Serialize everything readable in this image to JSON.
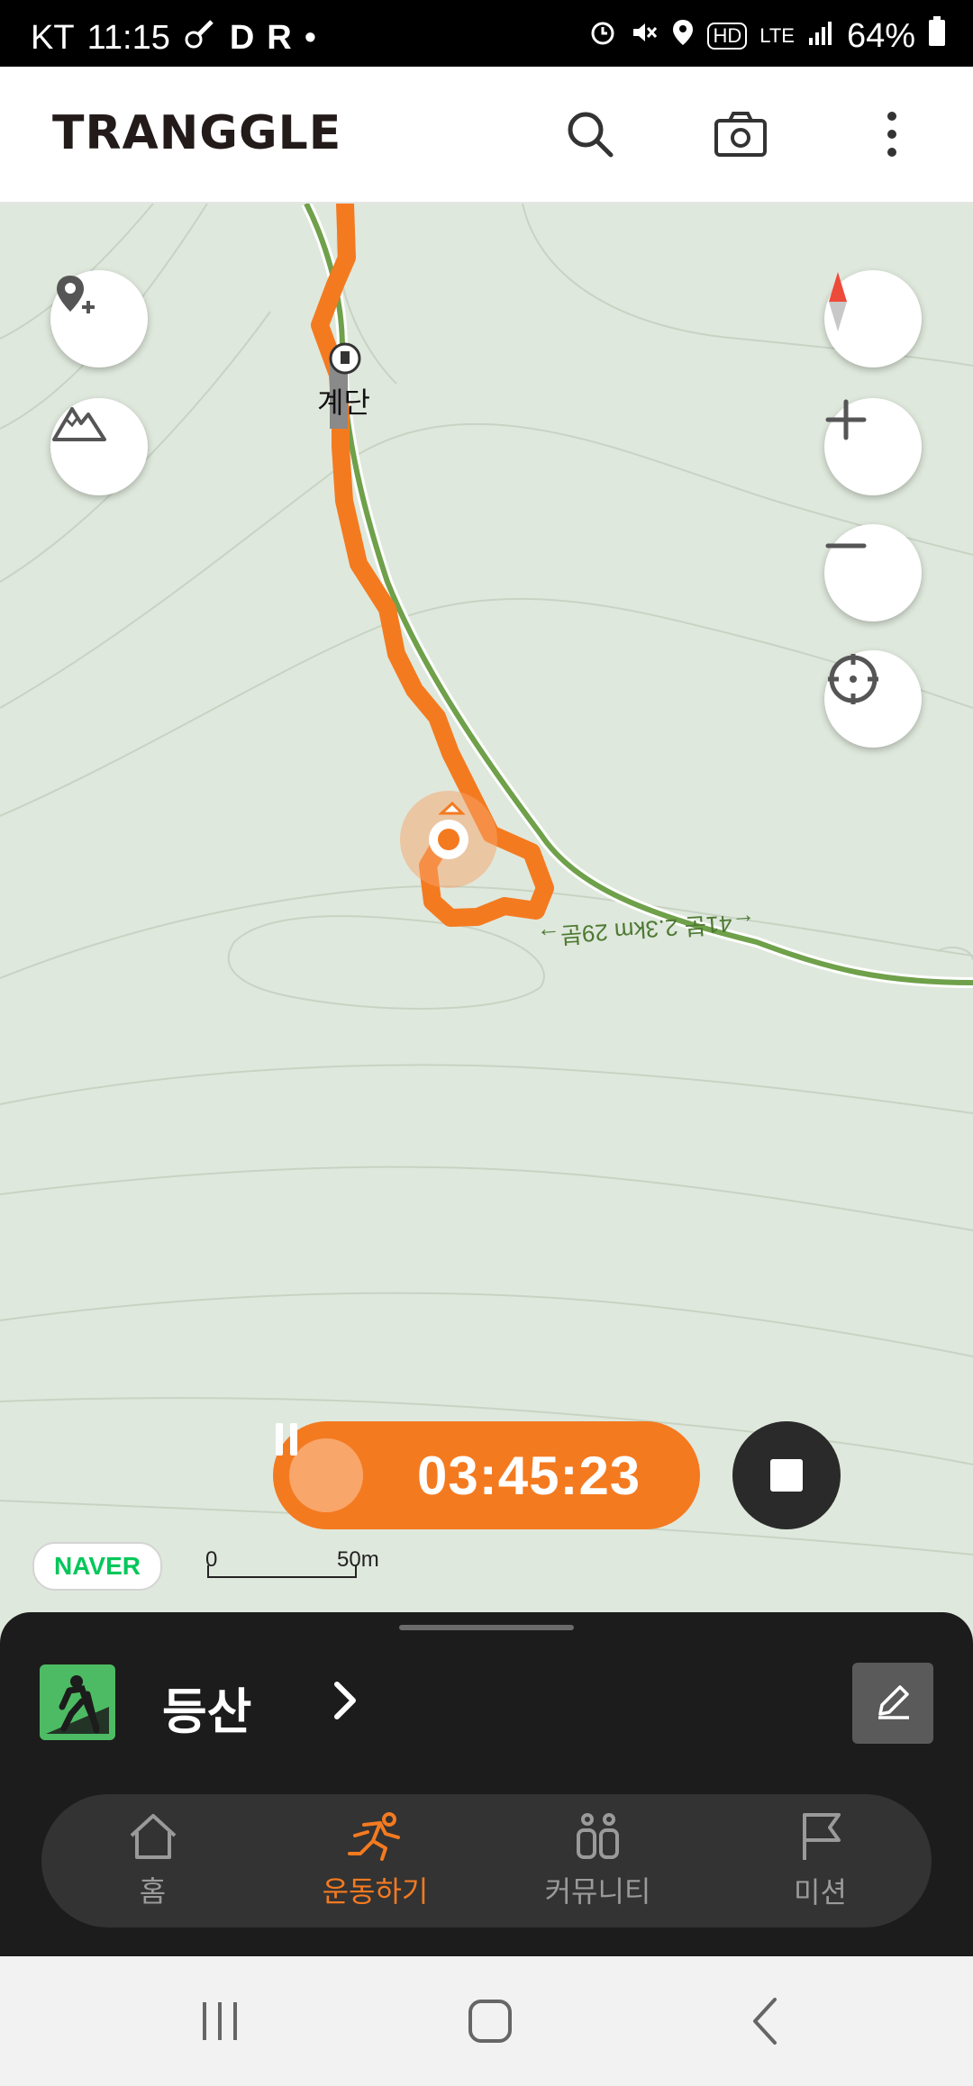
{
  "status_bar": {
    "carrier": "KT",
    "time": "11:15",
    "indicator_d": "D",
    "indicator_r": "R",
    "network": "LTE",
    "battery": "64%"
  },
  "header": {
    "logo": "TRANGGLE"
  },
  "map": {
    "poi_label": "계단",
    "trail_label": "←41분 2.3km 29분→",
    "attribution": "NAVER",
    "scale_start": "0",
    "scale_end": "50m"
  },
  "tracker": {
    "elapsed": "03:45:23"
  },
  "activity": {
    "name": "등산",
    "arrow": "›"
  },
  "tabs": [
    {
      "label": "홈",
      "icon": "home-icon"
    },
    {
      "label": "운동하기",
      "icon": "running-icon"
    },
    {
      "label": "커뮤니티",
      "icon": "community-icon"
    },
    {
      "label": "미션",
      "icon": "flag-icon"
    }
  ],
  "active_tab": "운동하기",
  "colors": {
    "accent": "#f47a20",
    "trail": "#6fa04a",
    "map_bg": "#dfe8dc",
    "sheet_bg": "#1c1c1c"
  }
}
